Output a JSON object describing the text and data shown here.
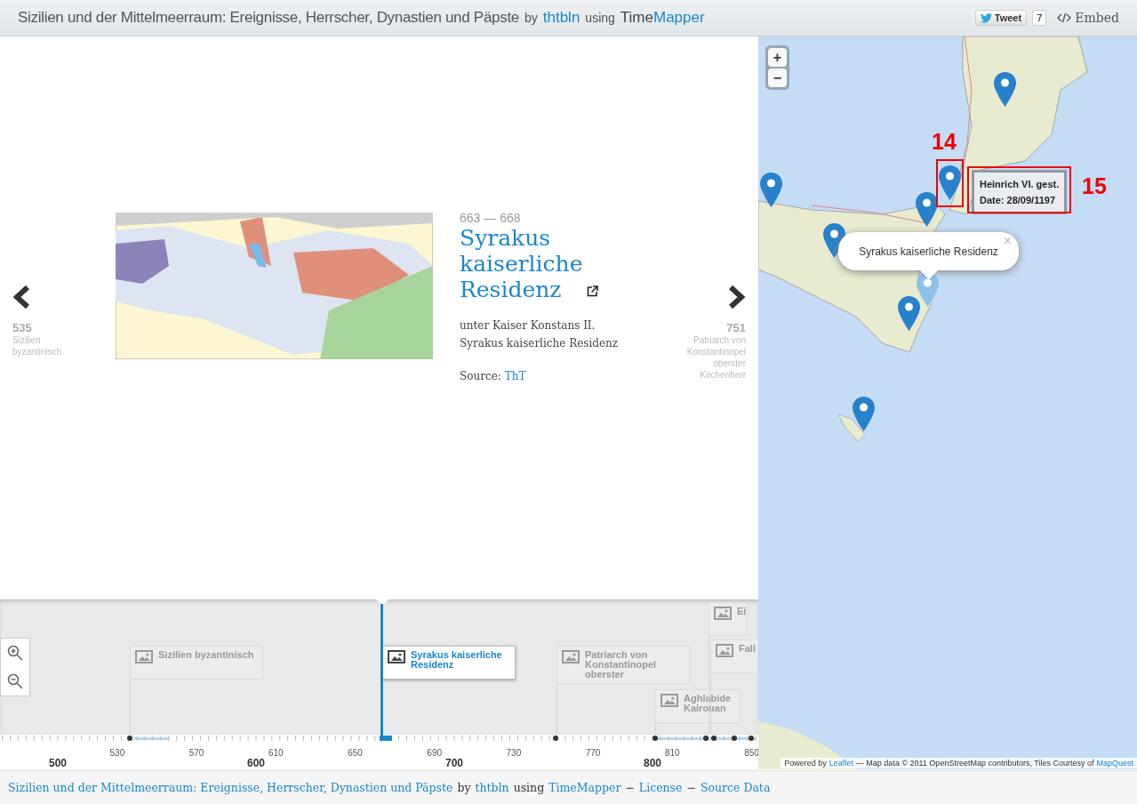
{
  "header": {
    "title": "Sizilien und der Mittelmeerraum: Ereignisse, Herrscher, Dynastien und Päpste",
    "by": "by",
    "author": "thtbln",
    "using": "using",
    "brand_first": "Time",
    "brand_second": "Mapper",
    "tweet": "Tweet",
    "tweet_count": "7",
    "embed": "Embed"
  },
  "slide": {
    "prev": {
      "date": "535",
      "title": "Sizilien byzantinisch"
    },
    "next": {
      "date": "751",
      "title": "Patriarch von Konstantinopel oberster Kirchenherr"
    },
    "date": "663 — 668",
    "title": "Syrakus kaiserliche Residenz",
    "description": "unter Kaiser Konstans II. Syrakus kaiserliche Residenz",
    "source_label": "Source:",
    "source": "ThT"
  },
  "timeline": {
    "events": [
      {
        "title": "Sizilien byzantinisch",
        "selected": false
      },
      {
        "title": "Syrakus kaiserliche Residenz",
        "selected": true
      },
      {
        "title": "Patriarch von Konstantinopel oberster",
        "selected": false
      },
      {
        "title": "Aghlabide Kairouan",
        "selected": false
      },
      {
        "title": "Ei",
        "selected": false
      },
      {
        "title": "Fall",
        "selected": false
      }
    ],
    "major_ticks": [
      "500",
      "600",
      "700",
      "800"
    ],
    "minor_ticks": [
      "530",
      "570",
      "610",
      "650",
      "690",
      "730",
      "770",
      "810",
      "850"
    ]
  },
  "map": {
    "markers": [
      {
        "selected": false
      },
      {
        "selected": false
      },
      {
        "selected": false
      },
      {
        "selected": false
      },
      {
        "selected": false
      },
      {
        "selected": true
      },
      {
        "selected": false
      },
      {
        "selected": false
      }
    ],
    "zoom_in": "+",
    "zoom_out": "−",
    "popup": {
      "text": "Syrakus kaiserliche Residenz",
      "close": "×"
    },
    "tooltip": {
      "title": "Heinrich VI. gest.",
      "date": "Date: 28/09/1197"
    },
    "annotations": [
      "14",
      "15"
    ],
    "attribution": {
      "prefix": "Powered by",
      "leaflet": "Leaflet",
      "middle": "— Map data © 2011 OpenStreetMap contributors, Tiles Courtesy of",
      "tiles": "MapQuest"
    }
  },
  "footer": {
    "title": "Sizilien und der Mittelmeerraum: Ereignisse, Herrscher, Dynastien und Päpste",
    "by": "by",
    "author": "thtbln",
    "using": "using",
    "brand": "TimeMapper",
    "sep1": "−",
    "license": "License",
    "sep2": "−",
    "source": "Source Data"
  }
}
